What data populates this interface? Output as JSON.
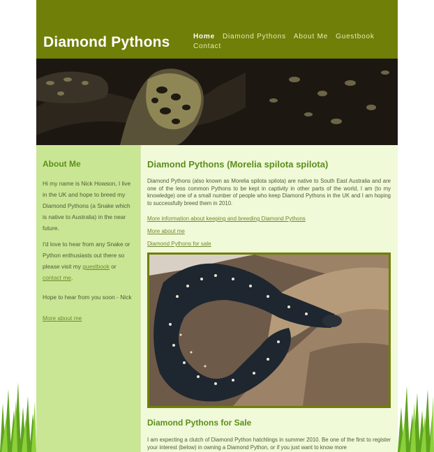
{
  "header": {
    "site_title": "Diamond Pythons",
    "nav": [
      "Home",
      "Diamond Pythons",
      "About Me",
      "Guestbook",
      "Contact"
    ]
  },
  "sidebar": {
    "heading": "About Me",
    "para1": "Hi my name is Nick Howson, I live in the UK and hope to breed my Diamond Pythons (a Snake which is native to Australia) in the near future.",
    "para2_start": "I'd love to hear from any Snake or Python enthusiasts out there so please visit my ",
    "guestbook_link": "guestbook",
    "para2_mid": " or ",
    "contact_link": "contact me",
    "para2_end": ".",
    "para3": "Hope to hear from you soon - Nick",
    "more_link": "More about me"
  },
  "main": {
    "heading": "Diamond Pythons (Morelia spilota spilota)",
    "intro": "Diamond Pythons (also known as Morelia spilota spilota) are native to South East Australia and are one of the less common Pythons to be kept in captivity in other parts of the world, I am (to my knowledge) one of a small number of people who keep Diamond Pythons in the UK and I am hoping to successfully breed them in 2010.",
    "link_info": "More information about keeping and breeding Diamond Pythons",
    "link_about": "More about me",
    "link_sale": "Diamond Pythons for sale",
    "sale_heading": "Diamond Pythons for Sale",
    "sale_text": "I am expecting a clutch of Diamond Python hatchlings in summer 2010. Be one of the first to register your interest (below) in owning a Diamond Python, or if you just want to know more"
  },
  "colors": {
    "header": "#6f7f08",
    "sidebar": "#c9e694",
    "content": "#f0f9d8",
    "heading": "#5b8f1c"
  }
}
